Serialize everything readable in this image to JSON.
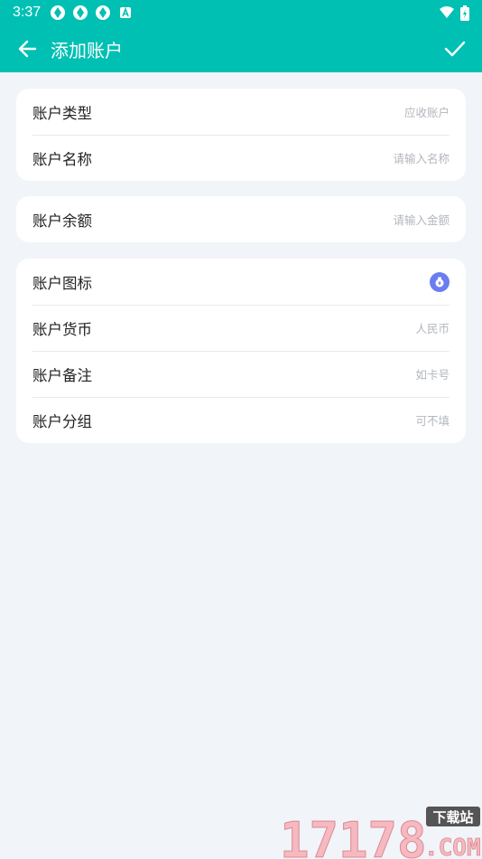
{
  "status": {
    "time": "3:37"
  },
  "header": {
    "title": "添加账户"
  },
  "groups": [
    {
      "rows": [
        {
          "label": "账户类型",
          "value": "应收账户"
        },
        {
          "label": "账户名称",
          "value": "请输入名称"
        }
      ]
    },
    {
      "rows": [
        {
          "label": "账户余额",
          "value": "请输入金额"
        }
      ]
    },
    {
      "rows": [
        {
          "label": "账户图标",
          "icon": "money-bag-icon"
        },
        {
          "label": "账户货币",
          "value": "人民币"
        },
        {
          "label": "账户备注",
          "value": "如卡号"
        },
        {
          "label": "账户分组",
          "value": "可不填"
        }
      ]
    }
  ],
  "watermark": {
    "text": "17178",
    "badge": "下载站",
    "suffix": ".COM"
  },
  "colors": {
    "accent": "#00c0b4",
    "background": "#f1f4f8",
    "icon_badge": "#6a7ef0"
  }
}
